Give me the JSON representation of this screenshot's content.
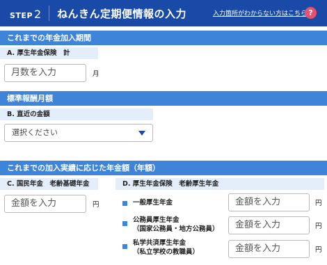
{
  "header": {
    "step_label": "STEP",
    "step_number": "2",
    "title": "ねんきん定期便情報の入力",
    "help_link": "入力箇所がわからない方はこちら",
    "help_icon_glyph": "?"
  },
  "section1": {
    "title": "これまでの年金加入期間",
    "fieldA": {
      "label": "A. 厚生年金保険　計",
      "placeholder": "月数を入力",
      "unit": "月"
    }
  },
  "section2": {
    "title": "標準報酬月額",
    "fieldB": {
      "label": "B. 直近の金額",
      "selected": "選択ください"
    }
  },
  "section3": {
    "title": "これまでの加入実績に応じた年金額（年額）",
    "fieldC": {
      "label": "C. 国民年金　老齢基礎年金",
      "placeholder": "金額を入力",
      "unit": "円"
    },
    "fieldD": {
      "label": "D. 厚生年金保険　老齢厚生年金",
      "rows": [
        {
          "line1": "一般厚生年金",
          "line2": "",
          "placeholder": "金額を入力",
          "unit": "円"
        },
        {
          "line1": "公務員厚生年金",
          "line2": "（国家公務員・地方公務員）",
          "placeholder": "金額を入力",
          "unit": "円"
        },
        {
          "line1": "私学共済厚生年金",
          "line2": "（私立学校の教職員）",
          "placeholder": "金額を入力",
          "unit": "円"
        }
      ]
    }
  },
  "colors": {
    "header_bg": "#1a4aa8",
    "section_bar": "#3e84d9",
    "label_bg": "#e4eefb",
    "help_icon": "#e8506f"
  }
}
